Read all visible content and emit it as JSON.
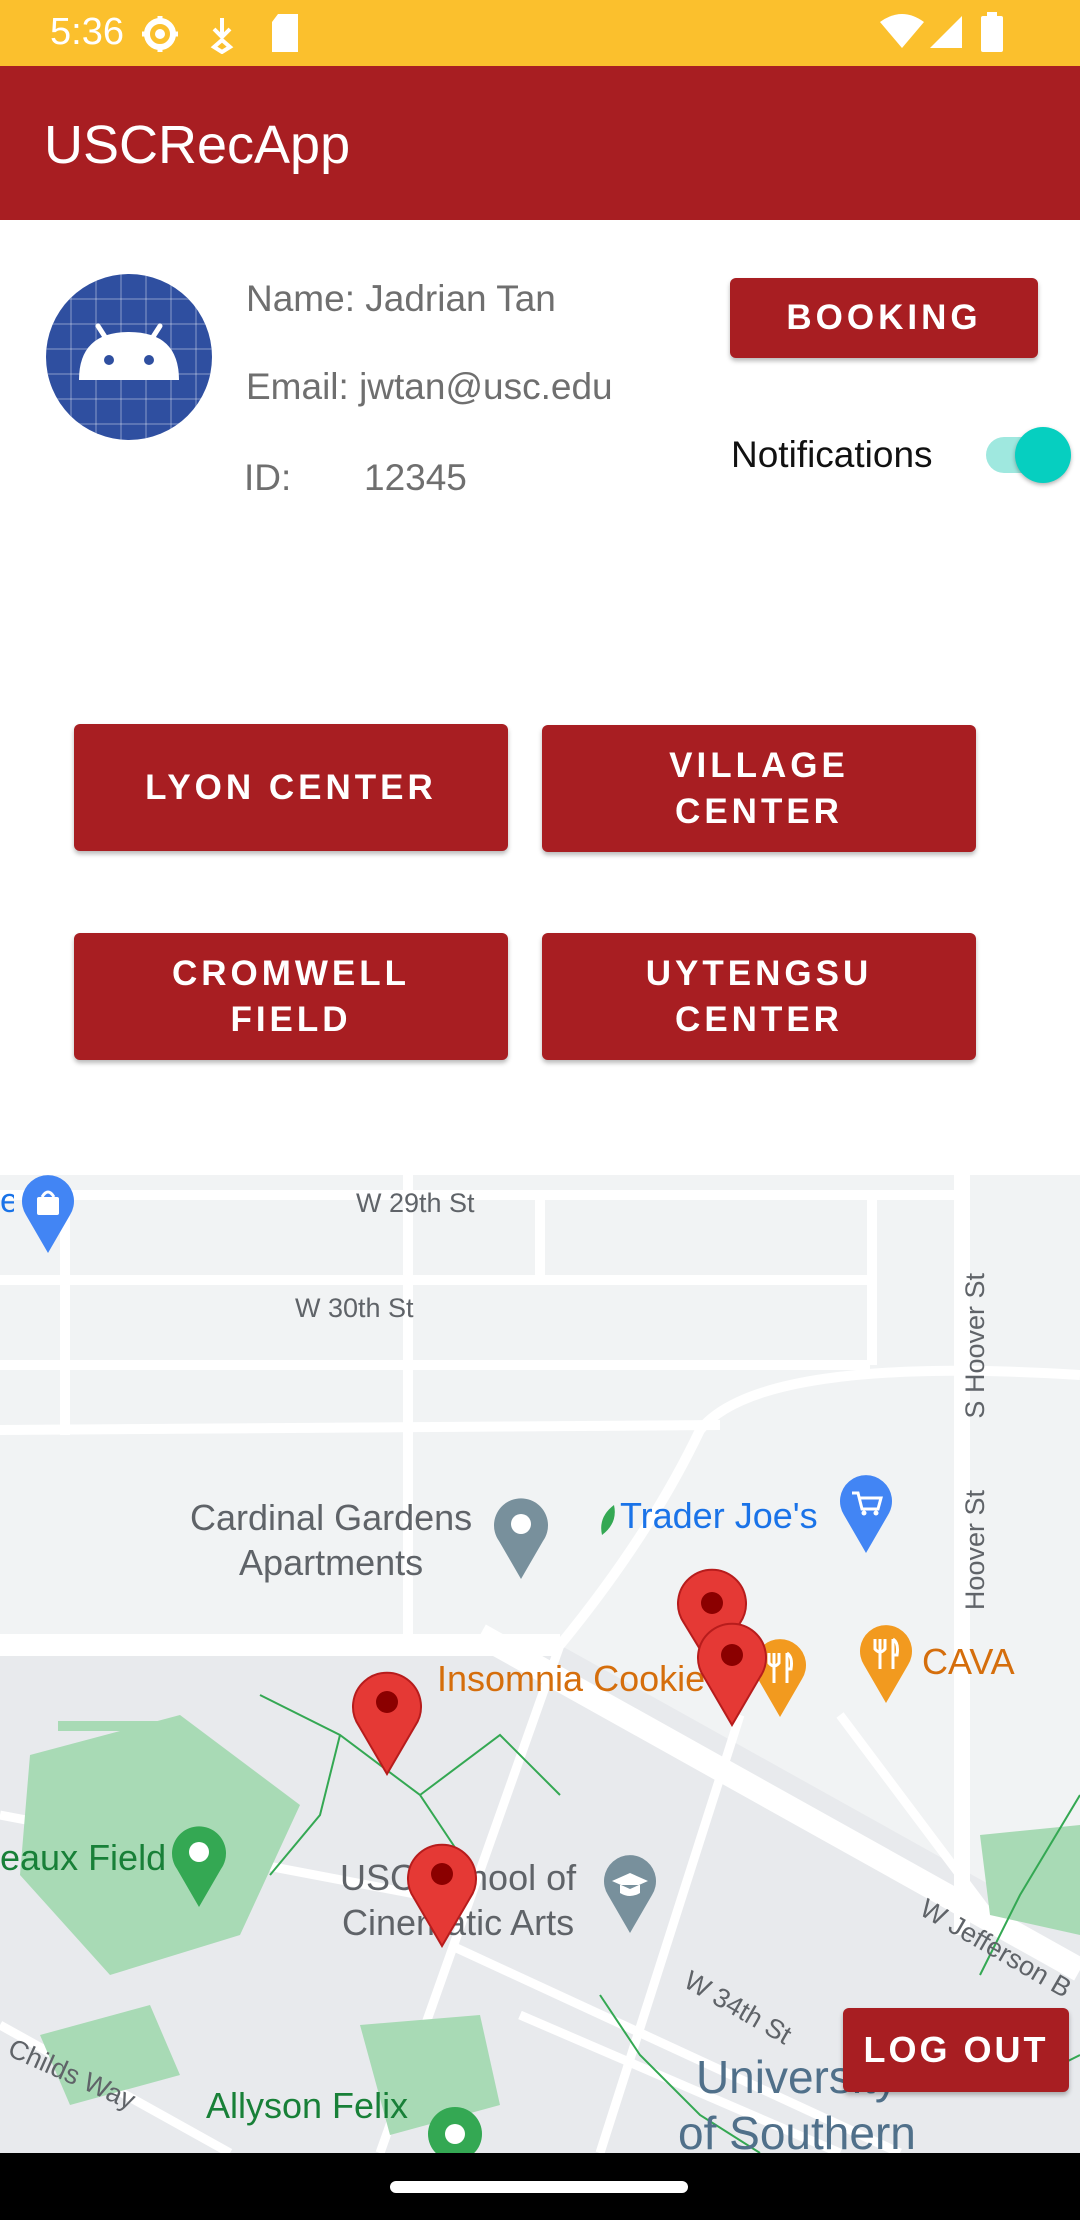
{
  "status_bar": {
    "time": "5:36"
  },
  "app_bar": {
    "title": "USCRecApp"
  },
  "profile": {
    "name": "Name: Jadrian Tan",
    "email": "Email:  jwtan@usc.edu",
    "id_label": "ID:",
    "id_value": "12345"
  },
  "actions": {
    "booking_label": "BOOKING",
    "notifications_label": "Notifications",
    "notifications_on": true
  },
  "centers": {
    "lyon": "LYON CENTER",
    "village": "VILLAGE\nCENTER",
    "cromwell": "CROMWELL\nFIELD",
    "uytengsu": "UYTENGSU\nCENTER"
  },
  "map": {
    "streets": {
      "w29": "W 29th St",
      "w30": "W 30th St",
      "hoover1": "S Hoover St",
      "hoover2": "Hoover St",
      "w34": "W 34th St",
      "jefferson": "W Jefferson B",
      "childs": "Childs Way"
    },
    "places": {
      "cardinal1": "Cardinal Gardens",
      "cardinal2": "Apartments",
      "traderjoes": "Trader Joe's",
      "insomnia": "Insomnia Cookie",
      "cava": "CAVA",
      "field": "eaux Field",
      "usc1": "USC School of",
      "usc2": "Cinematic Arts",
      "university1": "University",
      "university2": "of Southern",
      "allyson": "Allyson Felix",
      "edge": "e"
    },
    "colors": {
      "marker": "#e53935",
      "food": "#f29a1f",
      "poi_blue": "#4285f4",
      "poi_green": "#34a853"
    }
  },
  "logout_label": "LOG OUT"
}
